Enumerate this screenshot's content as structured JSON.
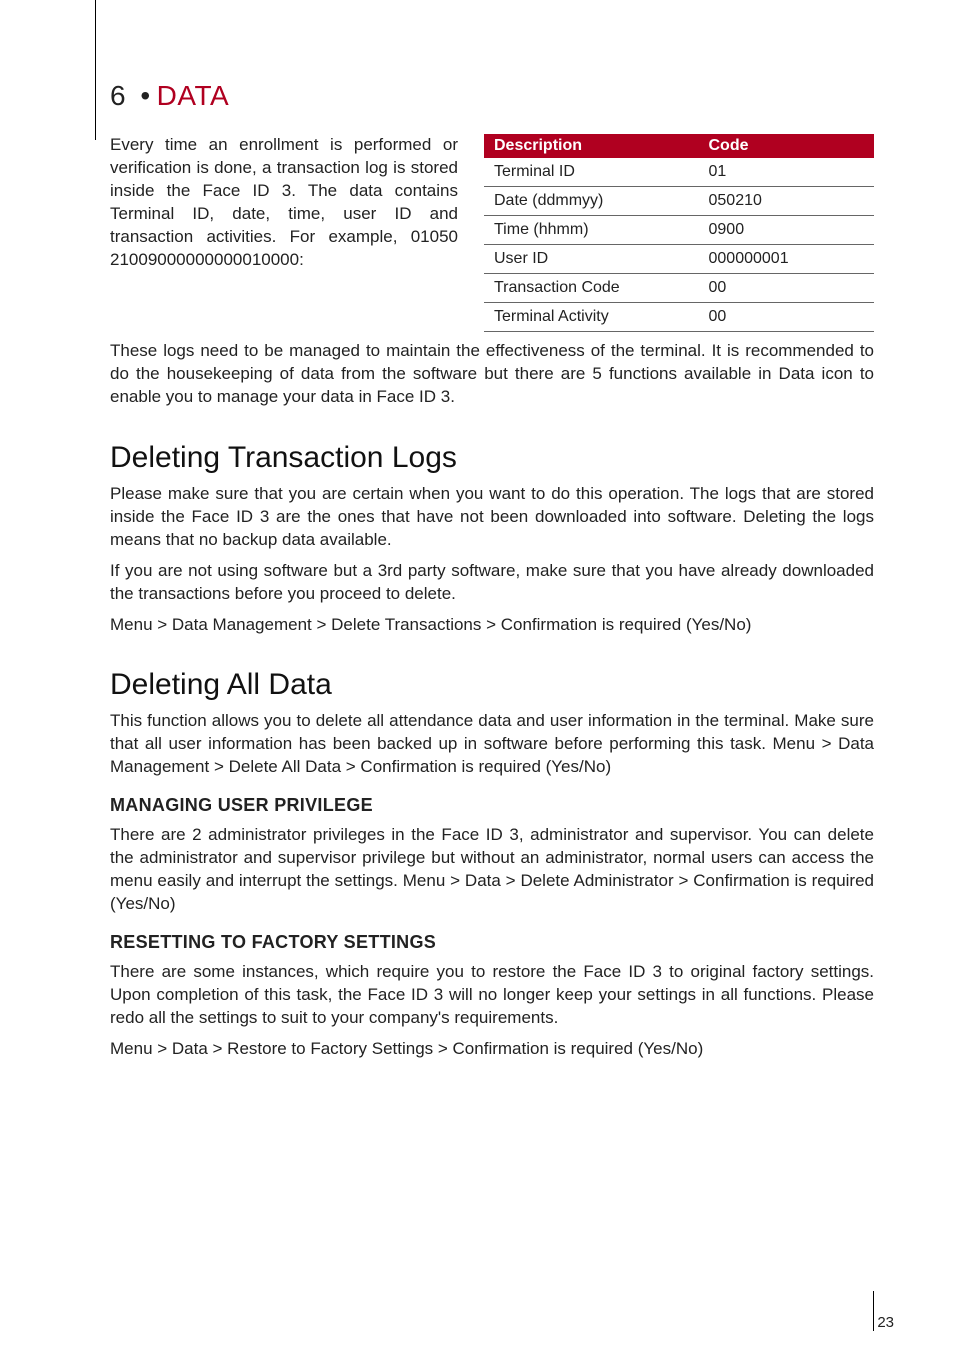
{
  "chapter": {
    "number": "6",
    "separator": "•",
    "title": "DATA"
  },
  "intro_paragraph": "Every time an enrollment is performed or verification is done, a transaction log is stored inside the Face ID 3. The data contains Terminal ID, date, time, user ID and transaction activities. For example, 01050 21009000000000010000:",
  "table": {
    "headers": [
      "Description",
      "Code"
    ],
    "rows": [
      [
        "Terminal ID",
        "01"
      ],
      [
        "Date (ddmmyy)",
        "050210"
      ],
      [
        "Time (hhmm)",
        "0900"
      ],
      [
        "User ID",
        "000000001"
      ],
      [
        "Transaction Code",
        "00"
      ],
      [
        "Terminal Activity",
        "00"
      ]
    ]
  },
  "after_table_paragraph": "These logs need to be managed to maintain the effectiveness of the terminal. It is recommended to do the housekeeping of data from the software but there are 5 functions available in Data icon to enable you to manage your data in Face ID 3.",
  "sections": {
    "delete_logs": {
      "heading": "Deleting Transaction Logs",
      "p1": "Please make sure that you are certain when you want to do this operation. The logs that are stored inside the Face ID 3 are the ones that have not been downloaded into software. Deleting the logs means that no backup data available.",
      "p2": "If you are not using software but a 3rd party software, make sure that you have already downloaded the transactions before you proceed to delete.",
      "p3": "Menu > Data Management > Delete Transactions > Confirmation is required (Yes/No)"
    },
    "delete_all": {
      "heading": "Deleting All Data",
      "p1": "This function allows you to delete all attendance data and user information in the terminal. Make sure that all user information has been backed up in software before performing this task. Menu > Data Management > Delete All Data > Confirmation is required (Yes/No)",
      "sub_privilege": {
        "heading": "MANAGING USER PRIVILEGE",
        "p": "There are 2 administrator privileges in the Face ID 3, administrator and supervisor. You can delete the administrator and supervisor privilege but without an administrator, normal users can access the menu easily and interrupt the settings. Menu > Data > Delete Administrator > Confirmation is required (Yes/No)"
      },
      "sub_reset": {
        "heading": "RESETTING TO FACTORY SETTINGS",
        "p1": "There are some instances, which require you to restore the Face ID 3 to original factory settings. Upon completion of this task, the Face ID 3 will no longer keep your settings in all functions. Please redo all the settings to suit to your company's requirements.",
        "p2": "Menu > Data > Restore to Factory Settings > Confirmation is required (Yes/No)"
      }
    }
  },
  "page_number": "23"
}
